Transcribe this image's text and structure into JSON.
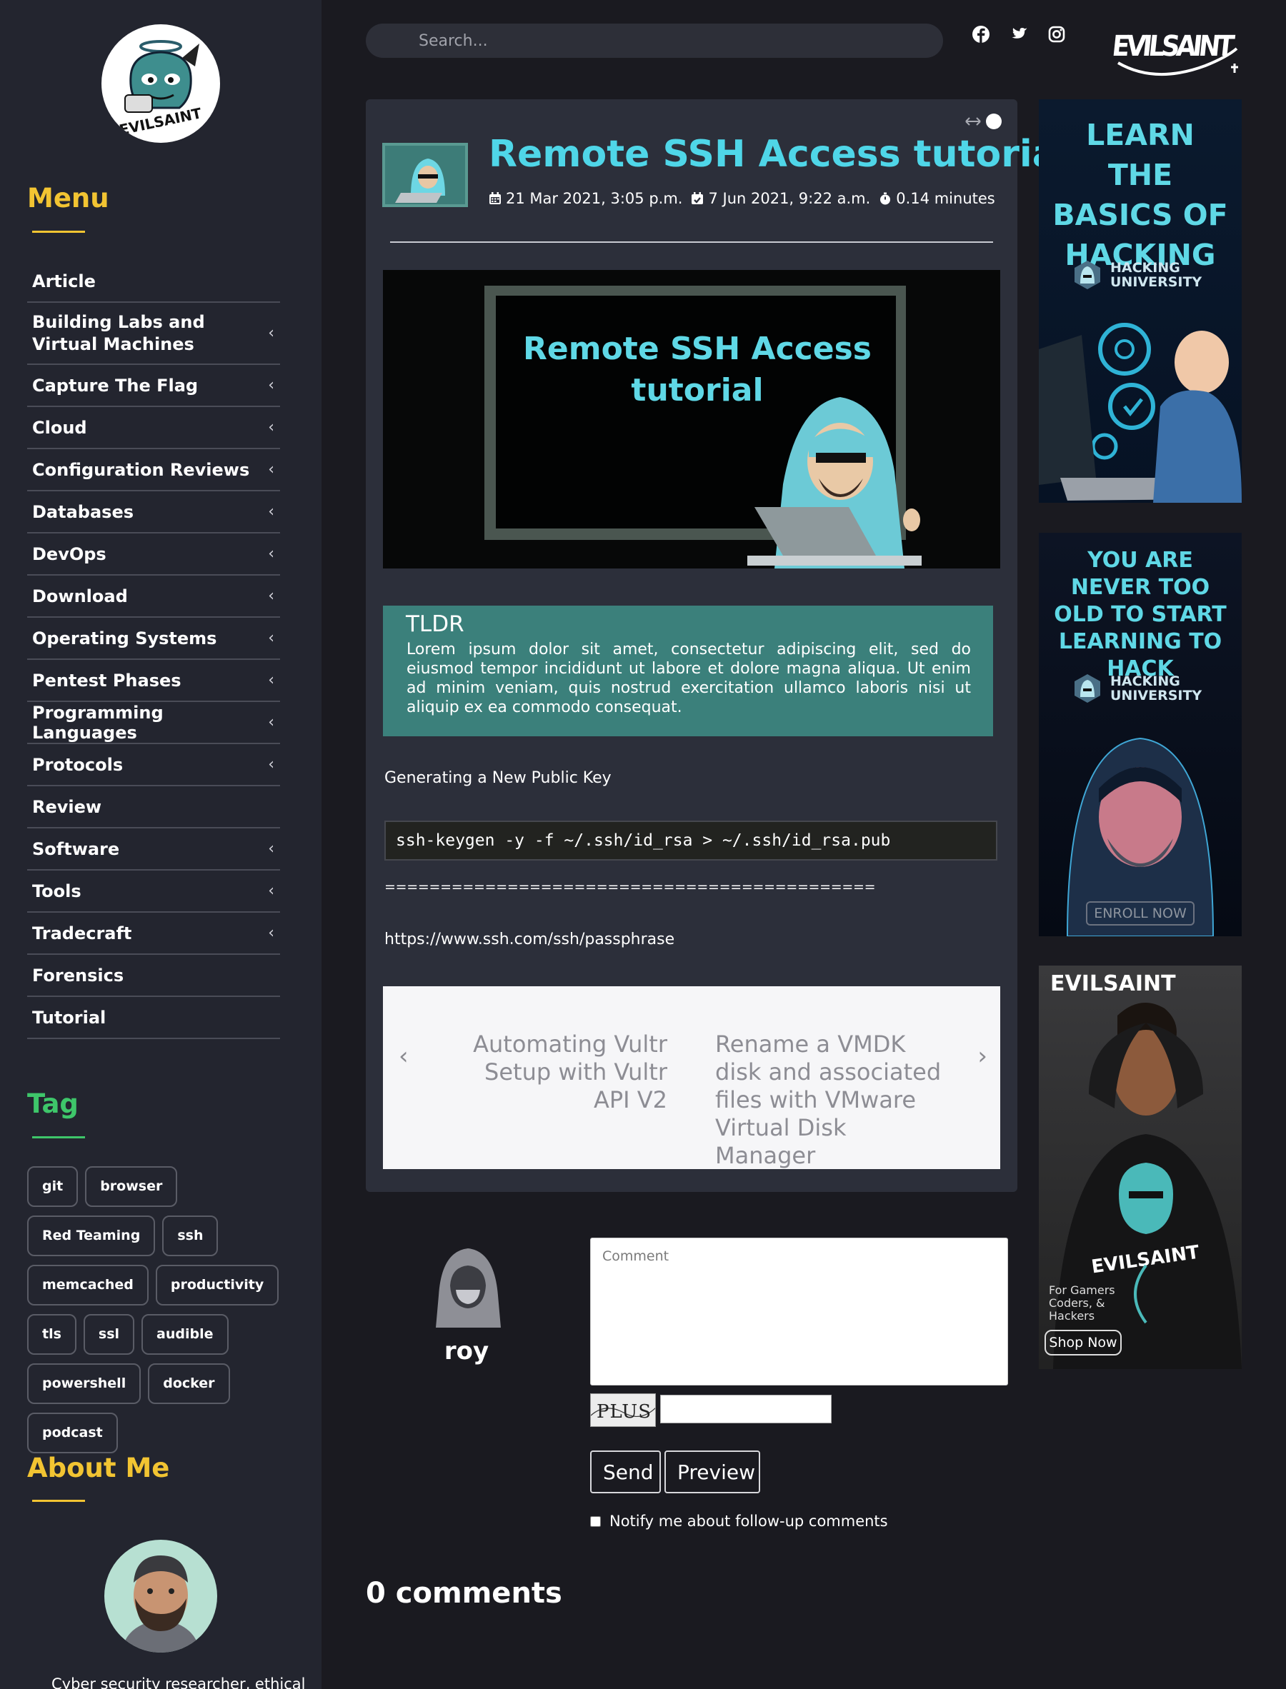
{
  "brand": {
    "logo_text": "EVILSAINT",
    "mini_logo_text": "EVILSAINT"
  },
  "sidebar": {
    "menu_title": "Menu",
    "menu": [
      {
        "label": "Article",
        "has_submenu": false
      },
      {
        "label": "Building Labs and Virtual Machines",
        "has_submenu": true
      },
      {
        "label": "Capture The Flag",
        "has_submenu": true
      },
      {
        "label": "Cloud",
        "has_submenu": true
      },
      {
        "label": "Configuration Reviews",
        "has_submenu": true
      },
      {
        "label": "Databases",
        "has_submenu": true
      },
      {
        "label": "DevOps",
        "has_submenu": true
      },
      {
        "label": "Download",
        "has_submenu": true
      },
      {
        "label": "Operating Systems",
        "has_submenu": true
      },
      {
        "label": "Pentest Phases",
        "has_submenu": true
      },
      {
        "label": "Programming Languages",
        "has_submenu": true
      },
      {
        "label": "Protocols",
        "has_submenu": true
      },
      {
        "label": "Review",
        "has_submenu": false
      },
      {
        "label": "Software",
        "has_submenu": true
      },
      {
        "label": "Tools",
        "has_submenu": true
      },
      {
        "label": "Tradecraft",
        "has_submenu": true
      },
      {
        "label": "Forensics",
        "has_submenu": false
      },
      {
        "label": "Tutorial",
        "has_submenu": false
      }
    ],
    "tag_title": "Tag",
    "tags": [
      "git",
      "browser",
      "Red Teaming",
      "ssh",
      "memcached",
      "productivity",
      "tls",
      "ssl",
      "audible",
      "powershell",
      "docker",
      "podcast"
    ],
    "about_title": "About Me",
    "about_text": "Cyber security researcher, ethical"
  },
  "search": {
    "placeholder": "Search..."
  },
  "social": [
    "facebook-icon",
    "twitter-icon",
    "instagram-icon"
  ],
  "article": {
    "title": "Remote SSH Access tutorial",
    "created": "21 Mar 2021, 3:05 p.m.",
    "updated": "7 Jun 2021, 9:22 a.m.",
    "read_time": "0.14 minutes",
    "hero_text": "Remote SSH Access tutorial",
    "tldr_title": "TLDR",
    "tldr_body": "Lorem ipsum dolor sit amet, consectetur adipiscing elit, sed do eiusmod tempor incididunt ut labore et dolore magna aliqua. Ut enim ad minim veniam, quis nostrud exercitation ullamco laboris nisi ut aliquip ex ea commodo consequat.",
    "paragraph": "Generating a New Public Key",
    "code": "ssh-keygen -y -f ~/.ssh/id_rsa > ~/.ssh/id_rsa.pub",
    "divider": "============================================",
    "link": "https://www.ssh.com/ssh/passphrase",
    "prev_post": "Automating Vultr Setup with Vultr API V2",
    "next_post": "Rename a VMDK disk and associated files with VMware Virtual Disk Manager"
  },
  "comment_form": {
    "user": "roy",
    "placeholder": "Comment",
    "captcha_text": "PLUS",
    "send_label": "Send",
    "preview_label": "Preview",
    "notify_label": "Notify me about follow-up comments",
    "notify_checked": false
  },
  "comments_count": "0 comments",
  "ads": {
    "ad1_text": "LEARN THE BASICS OF HACKING",
    "ad2_text": "YOU ARE NEVER TOO OLD TO START LEARNING TO HACK",
    "hu_line1": "HACKING",
    "hu_line2": "UNIVERSITY",
    "enroll": "ENROLL NOW",
    "ad3_logo": "EVILSAINT",
    "ad3_tagline": "For Gamers Coders, & Hackers",
    "shop": "Shop Now"
  },
  "colors": {
    "accent_title": "#4fd6e8",
    "menu_heading": "#f2c432",
    "tag_heading": "#3ec66a",
    "tldr_bg": "#3b807b"
  }
}
